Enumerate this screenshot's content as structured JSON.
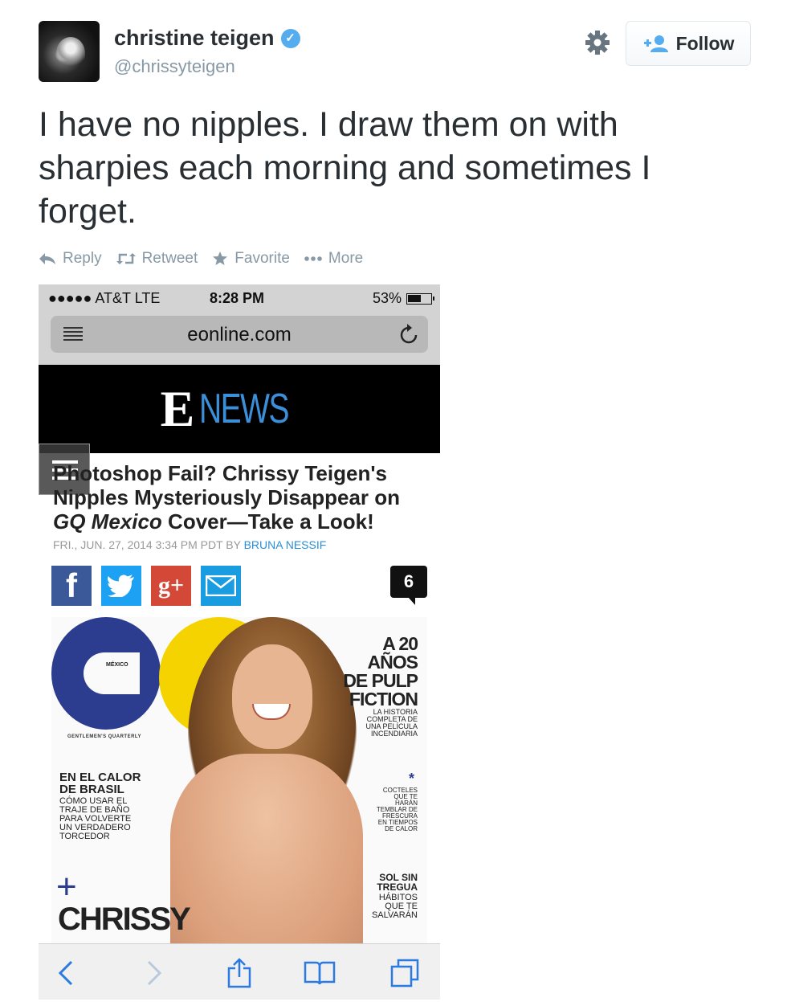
{
  "tweet": {
    "display_name": "christine teigen",
    "verified_mark": "✓",
    "handle": "@chrissyteigen",
    "text": "I have no nipples. I draw them on with sharpies each morning and sometimes I forget.",
    "follow_label": "Follow",
    "actions": {
      "reply": "Reply",
      "retweet": "Retweet",
      "favorite": "Favorite",
      "more": "More"
    }
  },
  "screenshot": {
    "status": {
      "carrier": "●●●●● AT&T  LTE",
      "time": "8:28 PM",
      "battery": "53%"
    },
    "url": "eonline.com",
    "site_logo_e": "E",
    "site_logo_news": "NEWS",
    "headline_part1": "Photoshop Fail? Chrissy Teigen's Nipples Mysteriously Disappear on ",
    "headline_italic": "GQ Mexico",
    "headline_part2": " Cover—Take a Look!",
    "byline_date": "FRI., JUN. 27, 2014 3:34 PM PDT BY ",
    "byline_author": "BRUNA NESSIF",
    "comment_count": "6",
    "cover": {
      "mexico": "MÉXICO",
      "gentlemens": "GENTLEMEN'S QUARTERLY",
      "anos": "A 20\nAÑOS\nDE PULP\nFICTION",
      "anos_sub": "LA HISTORIA\nCOMPLETA DE\nUNA PELÍCULA\nINCENDIARIA",
      "calor": "EN EL CALOR\nDE BRASIL",
      "calor_sub": "CÓMO USAR EL\nTRAJE DE BAÑO\nPARA VOLVERTE\nUN VERDADERO\nTORCEDOR",
      "star": "*",
      "cocteles": "COCTELES\nQUE TE\nHARÁN\nTEMBLAR DE\nFRESCURA\nEN TIEMPOS\nDE CALOR",
      "sol": "SOL SIN\nTREGUA",
      "sol_sub": "HÁBITOS\nQUE TE\nSALVARÁN",
      "plus": "+",
      "chrissy": "CHRISSY"
    }
  },
  "colors": {
    "twitter_blue": "#55acee",
    "text_dark": "#292f33",
    "muted": "#8899a6",
    "facebook": "#3b5998",
    "twitter_share": "#1da1f2",
    "gplus": "#d34836",
    "email": "#1a9ce0",
    "gq_blue": "#2c3d8f",
    "gq_yellow": "#f5d300",
    "news_blue": "#3b8fd8"
  },
  "icons": [
    "gear-icon",
    "add-user-icon",
    "reply-icon",
    "retweet-icon",
    "star-icon",
    "more-dots-icon",
    "reader-icon",
    "reload-icon",
    "facebook-icon",
    "twitter-icon",
    "google-plus-icon",
    "mail-icon",
    "back-icon",
    "forward-icon",
    "share-icon",
    "bookmarks-icon",
    "tabs-icon"
  ]
}
